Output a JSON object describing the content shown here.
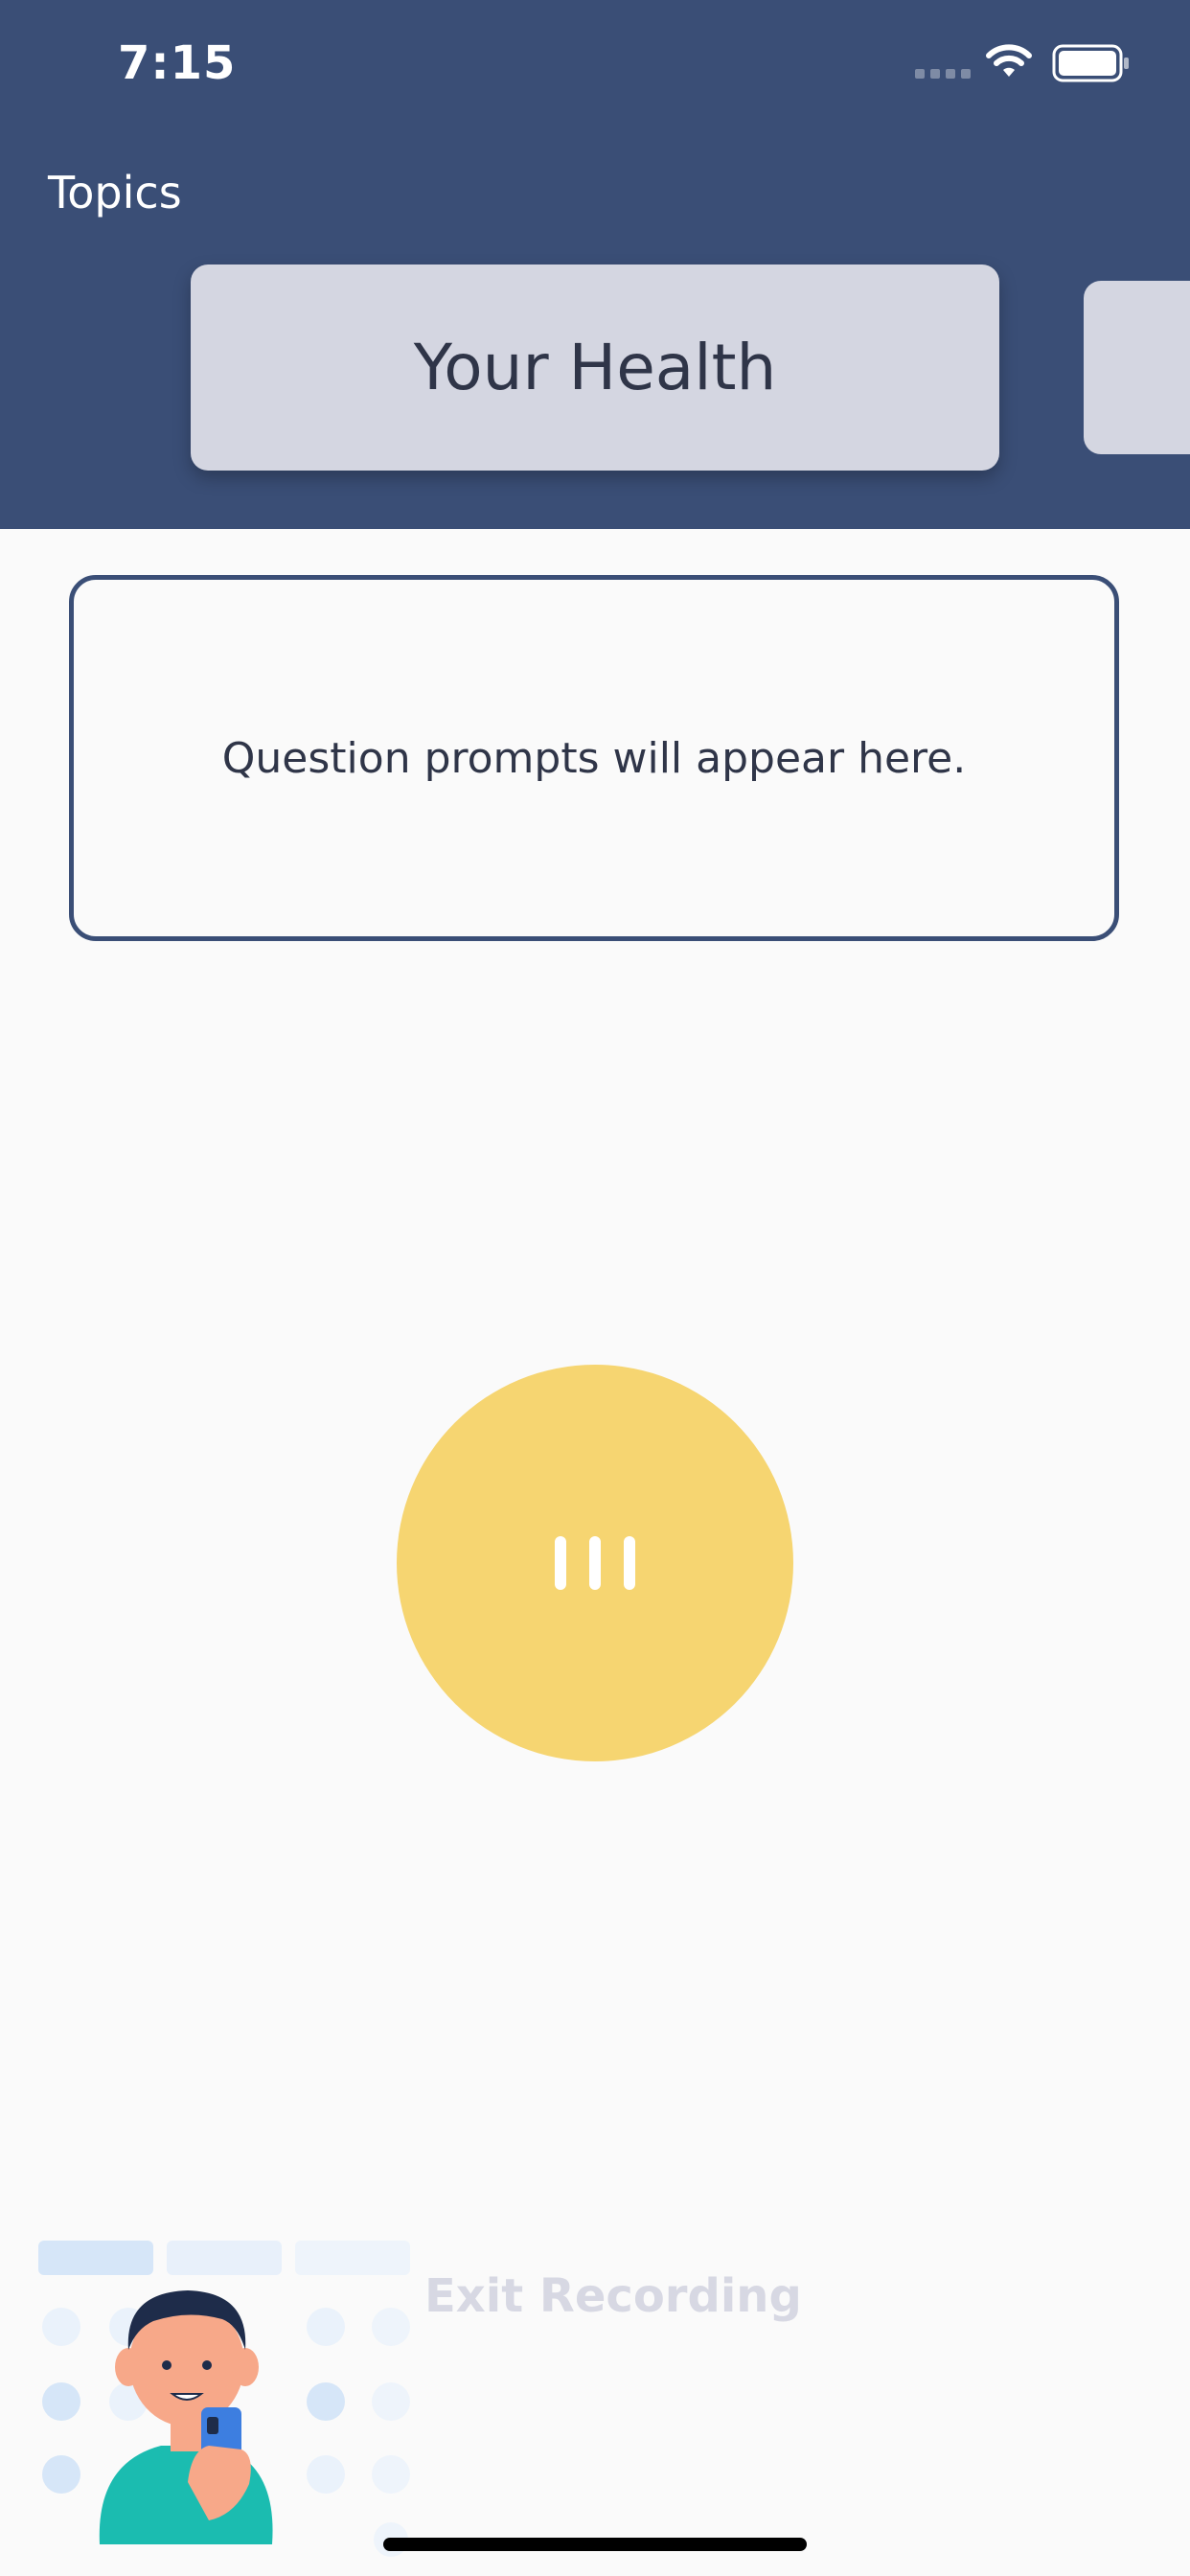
{
  "status_bar": {
    "time": "7:15"
  },
  "header": {
    "topics_label": "Topics",
    "current_topic": "Your Health"
  },
  "prompt": {
    "text": "Question prompts will appear here."
  },
  "record_button": {
    "icon": "pause-icon",
    "color": "#f6d571"
  },
  "footer": {
    "exit_label": "Exit Recording"
  },
  "colors": {
    "header": "#3a4e76",
    "card": "#d4d6e1",
    "background": "#fafafa"
  }
}
